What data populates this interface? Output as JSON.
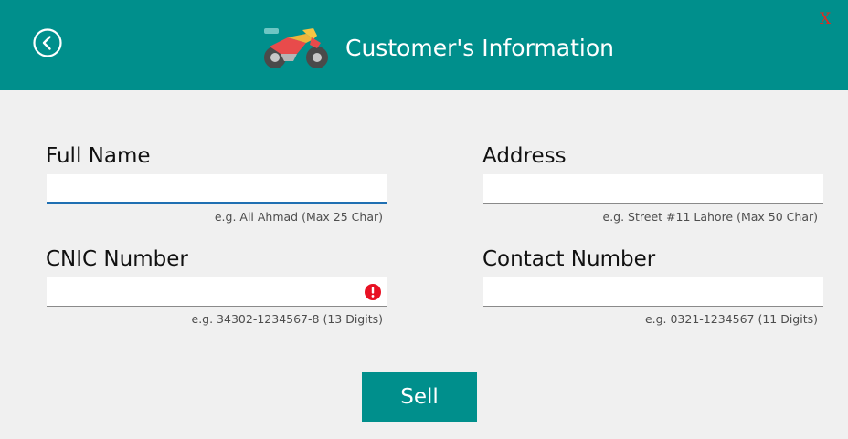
{
  "header": {
    "title": "Customer's Information",
    "close_label": "X"
  },
  "form": {
    "full_name": {
      "label": "Full Name",
      "value": "",
      "hint": "e.g. Ali Ahmad (Max 25 Char)"
    },
    "address": {
      "label": "Address",
      "value": "",
      "hint": "e.g. Street #11 Lahore (Max 50 Char)"
    },
    "cnic": {
      "label": "CNIC Number",
      "value": "",
      "hint": "e.g. 34302-1234567-8 (13 Digits)"
    },
    "contact": {
      "label": "Contact Number",
      "value": "",
      "hint": "e.g. 0321-1234567 (11 Digits)"
    },
    "sell_label": "Sell"
  },
  "colors": {
    "header_bg": "#008f8c",
    "accent_button": "#008f8c",
    "close_red": "#e02a20",
    "error_red": "#e81123",
    "focus_blue": "#1f6fb2"
  },
  "icons": {
    "back": "back-arrow-circle-icon",
    "logo": "motorcycle-icon",
    "error": "error-exclamation-icon"
  }
}
